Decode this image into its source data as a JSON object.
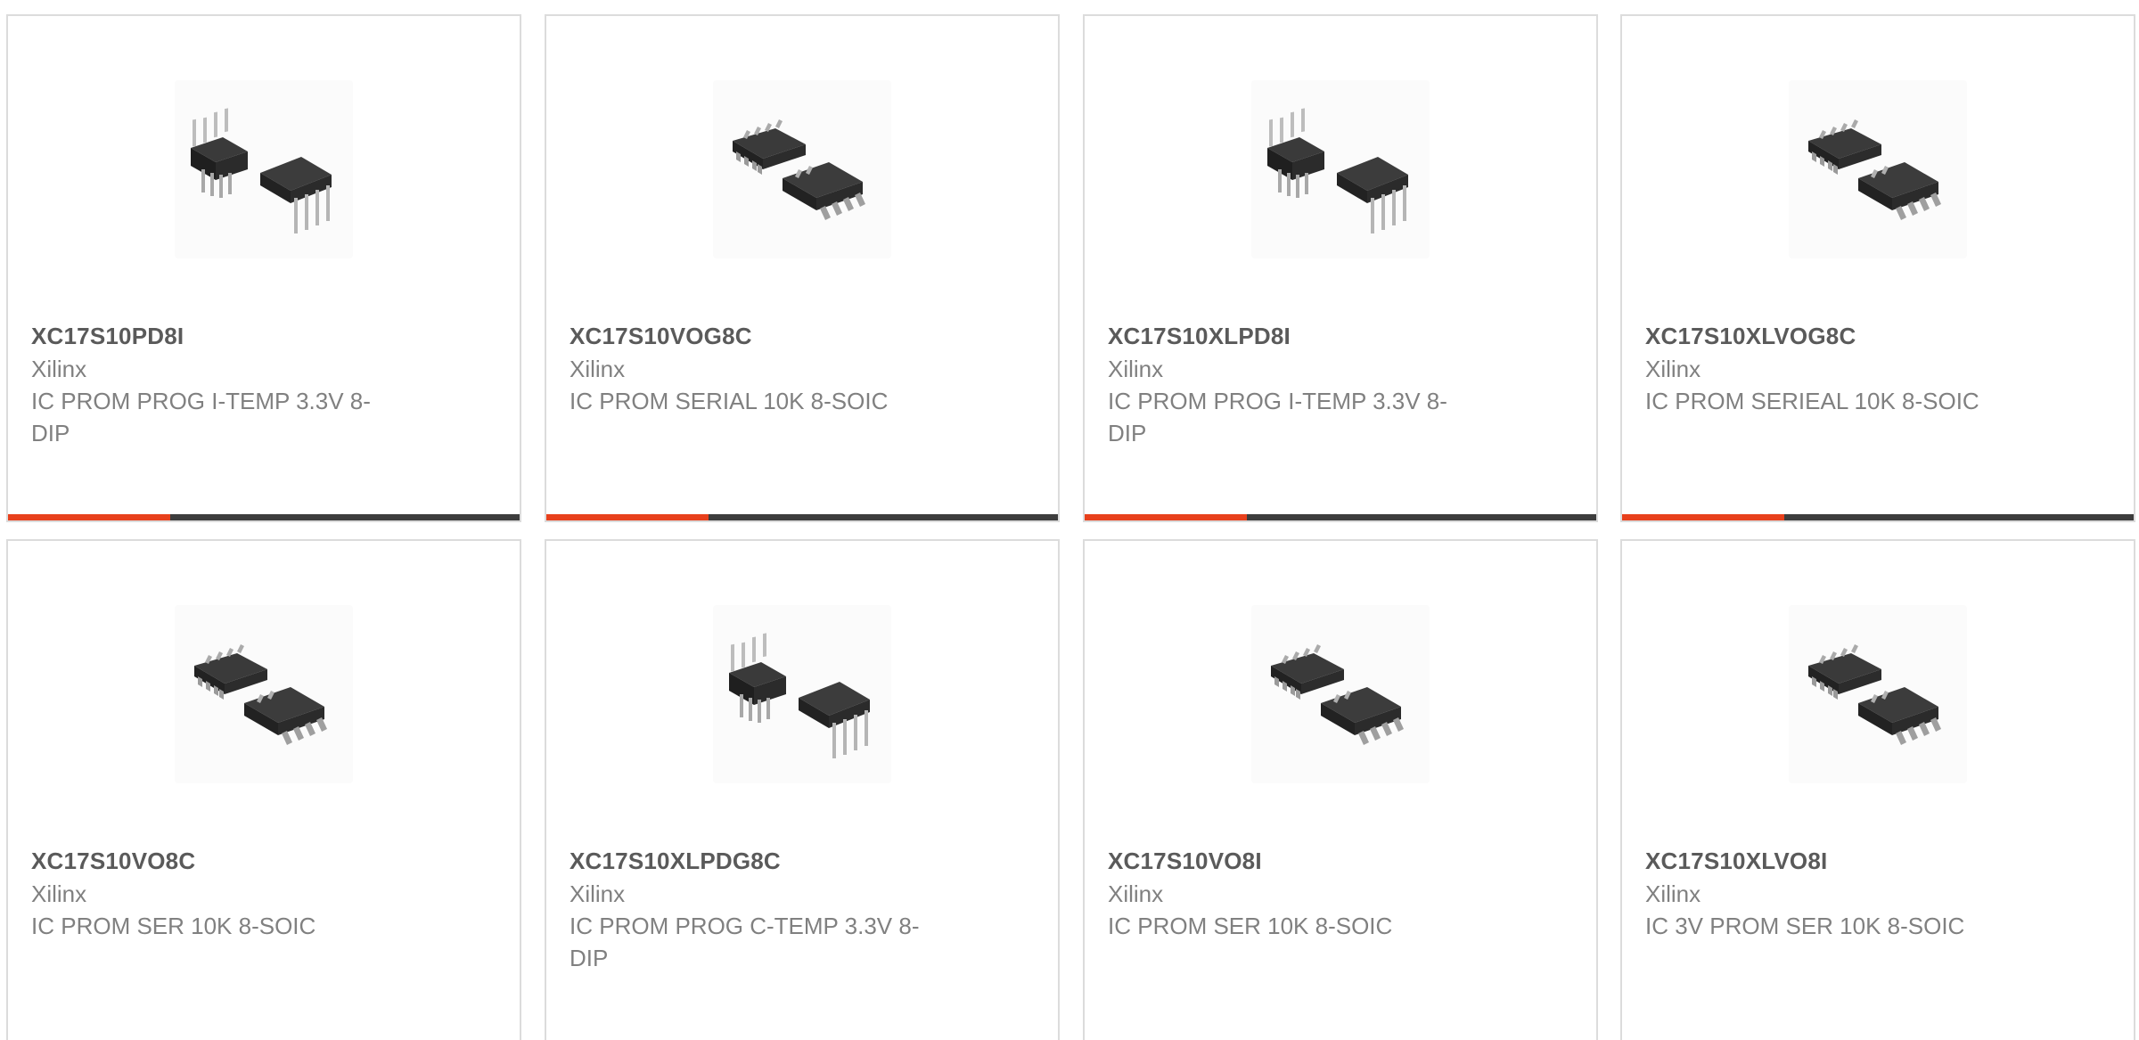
{
  "colors": {
    "accent": "#e8401c",
    "bar_dark": "#3d3d3d",
    "part_number": "#5a5a5a",
    "text_muted": "#808080",
    "card_border": "#dcdcdc"
  },
  "products": [
    {
      "part_number": "XC17S10PD8I",
      "manufacturer": "Xilinx",
      "description": "IC PROM PROG I-TEMP 3.3V 8-DIP",
      "image_icon": "dip-soic-chip-icon"
    },
    {
      "part_number": "XC17S10VOG8C",
      "manufacturer": "Xilinx",
      "description": "IC PROM SERIAL 10K 8-SOIC",
      "image_icon": "soic-chip-icon"
    },
    {
      "part_number": "XC17S10XLPD8I",
      "manufacturer": "Xilinx",
      "description": "IC PROM PROG I-TEMP 3.3V 8-DIP",
      "image_icon": "dip-soic-chip-icon"
    },
    {
      "part_number": "XC17S10XLVOG8C",
      "manufacturer": "Xilinx",
      "description": "IC PROM SERIEAL 10K 8-SOIC",
      "image_icon": "soic-chip-icon"
    },
    {
      "part_number": "XC17S10VO8C",
      "manufacturer": "Xilinx",
      "description": "IC PROM SER 10K 8-SOIC",
      "image_icon": "soic-chip-icon"
    },
    {
      "part_number": "XC17S10XLPDG8C",
      "manufacturer": "Xilinx",
      "description": "IC PROM PROG C-TEMP 3.3V 8-DIP",
      "image_icon": "dip-soic-chip-icon"
    },
    {
      "part_number": "XC17S10VO8I",
      "manufacturer": "Xilinx",
      "description": "IC PROM SER 10K 8-SOIC",
      "image_icon": "soic-chip-icon"
    },
    {
      "part_number": "XC17S10XLVO8I",
      "manufacturer": "Xilinx",
      "description": "IC 3V PROM SER 10K 8-SOIC",
      "image_icon": "soic-chip-icon"
    }
  ]
}
